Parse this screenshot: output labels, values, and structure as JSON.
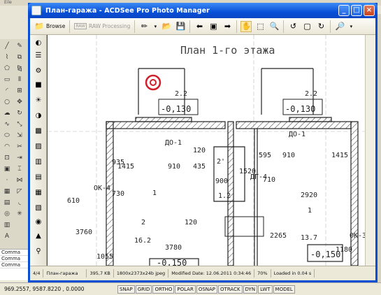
{
  "background_app": {
    "menu_fragment": "Eile",
    "command_lines": [
      "Comma",
      "Comma",
      "Comma"
    ],
    "status": {
      "coords": "969.2557, 9587.8220 , 0.0000",
      "toggles": [
        "SNAP",
        "GRID",
        "ORTHO",
        "POLAR",
        "OSNAP",
        "OTRACK",
        "DYN",
        "LWT",
        "MODEL"
      ]
    }
  },
  "window": {
    "title": "План-гаража - ACDSee Pro Photo Manager",
    "controls": [
      "_",
      "□",
      "×"
    ]
  },
  "toolbar": {
    "browse_label": "Browse",
    "raw_badge": "RAW",
    "raw_processing_label": "RAW Processing"
  },
  "drawing": {
    "title": "План 1-го этажа",
    "labels": [
      "2.2",
      "-0,130",
      "2.2",
      "-0,130",
      "ДО-1",
      "ДО-1",
      "1415",
      "910",
      "120",
      "435",
      "2'",
      "595",
      "910",
      "1415",
      "ОК-4",
      "935",
      "730",
      "610",
      "1",
      "900",
      "1.2",
      "ДГ-4",
      "710",
      "2920",
      "2",
      "16.2",
      "120",
      "1520",
      "1",
      "13.7",
      "2265",
      "-0,150",
      "1180",
      "ОК-3",
      "3780",
      "3760",
      "1055",
      "-0,150"
    ]
  },
  "statusbar": {
    "position": "4/4",
    "filename": "План-гаража",
    "size": "395,7 KB",
    "dimensions": "1800x2373x24b jpeg",
    "modified": "Modified Date: 12.06.2011 0:34:46",
    "zoom": "70%",
    "loaded": "Loaded in 0.04 s"
  },
  "colors": {
    "title_bar": "#0a4fd3",
    "target_marker": "#d0202a",
    "drawing_lines": "#222222"
  }
}
